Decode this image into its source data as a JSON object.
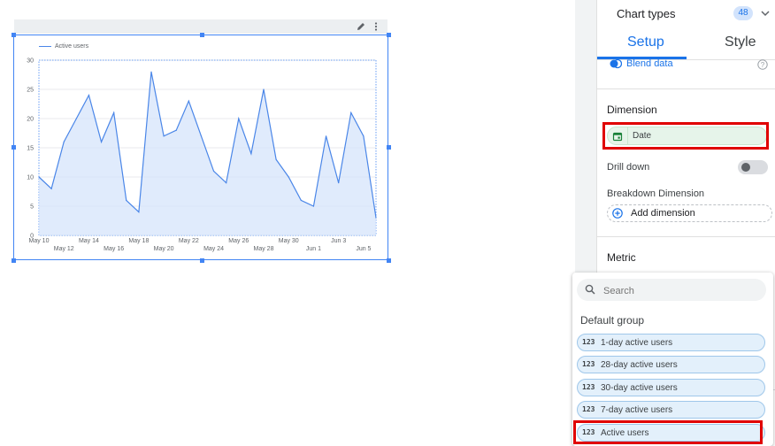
{
  "chart": {
    "legend_label": "Active users"
  },
  "chart_data": {
    "type": "area",
    "title": "",
    "series": [
      {
        "name": "Active users",
        "values": [
          10,
          8,
          16,
          20,
          24,
          16,
          21,
          6,
          4,
          28,
          17,
          18,
          23,
          17,
          11,
          9,
          20,
          14,
          25,
          13,
          10,
          6,
          5,
          17,
          9,
          21,
          17,
          3
        ]
      }
    ],
    "x": [
      "May 10",
      "May 11",
      "May 12",
      "May 13",
      "May 14",
      "May 15",
      "May 16",
      "May 17",
      "May 18",
      "May 19",
      "May 20",
      "May 21",
      "May 22",
      "May 23",
      "May 24",
      "May 25",
      "May 26",
      "May 27",
      "May 28",
      "May 29",
      "May 30",
      "May 31",
      "Jun 1",
      "Jun 2",
      "Jun 3",
      "Jun 4",
      "Jun 5",
      "Jun 6"
    ],
    "x_tick_labels_row1": [
      "May 10",
      "May 14",
      "May 18",
      "May 22",
      "May 26",
      "May 30",
      "Jun 3"
    ],
    "x_tick_labels_row2": [
      "May 12",
      "May 16",
      "May 20",
      "May 24",
      "May 28",
      "Jun 1",
      "Jun 5"
    ],
    "y_ticks": [
      "0",
      "5",
      "10",
      "15",
      "20",
      "25",
      "30"
    ],
    "ylim": [
      0,
      30
    ],
    "grid": true,
    "legend": "top-left",
    "colors": {
      "line": "#4a86e8",
      "fill": "#d6e4fb"
    }
  },
  "panel": {
    "title": "Chart types",
    "count": "48",
    "tabs": [
      "Setup",
      "Style"
    ],
    "blend_label": "Blend data",
    "dimension_heading": "Dimension",
    "dimension_value": "Date",
    "drill_down_label": "Drill down",
    "breakdown_label": "Breakdown Dimension",
    "add_dimension_label": "Add dimension",
    "metric_heading": "Metric"
  },
  "dropdown": {
    "search_placeholder": "Search",
    "group_label": "Default group",
    "metric_type_icon": "123",
    "items": [
      "1-day active users",
      "28-day active users",
      "30-day active users",
      "7-day active users",
      "Active users"
    ]
  },
  "icons": {
    "edit": "pencil-icon",
    "more": "more-vert-icon",
    "expand": "chevron-down-icon",
    "blend": "blend-icon",
    "help": "help-icon",
    "calendar": "calendar-icon",
    "add": "add-circle-icon",
    "search": "search-icon"
  },
  "highlight_color": "#e00000"
}
